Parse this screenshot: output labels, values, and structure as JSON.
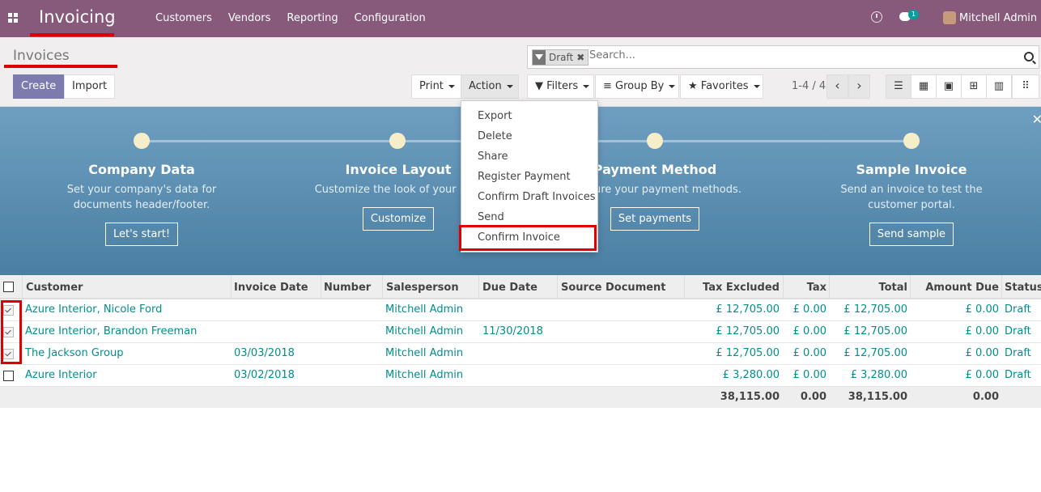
{
  "navbar": {
    "app_title": "Invoicing",
    "menu": [
      "Customers",
      "Vendors",
      "Reporting",
      "Configuration"
    ],
    "chat_badge": "1",
    "user_name": "Mitchell Admin"
  },
  "control_panel": {
    "title": "Invoices",
    "facet_label": "Draft",
    "facet_close": "✖",
    "search_placeholder": "Search...",
    "create_label": "Create",
    "import_label": "Import",
    "print_label": "Print",
    "action_label": "Action",
    "filters_label": "Filters",
    "groupby_label": "Group By",
    "favorites_label": "Favorites",
    "pager": "1-4 / 4",
    "prev": "‹",
    "next": "›"
  },
  "action_menu": {
    "items": [
      "Export",
      "Delete",
      "Share",
      "Register Payment",
      "Confirm Draft Invoices",
      "Send",
      "Confirm Invoice"
    ]
  },
  "banner": {
    "close": "✕",
    "steps": [
      {
        "title": "Company Data",
        "desc1": "Set your company's data for",
        "desc2": "documents header/footer.",
        "button": "Let's start!"
      },
      {
        "title": "Invoice Layout",
        "desc1": "Customize the look of your invo",
        "desc2": "",
        "button": "Customize"
      },
      {
        "title": "Payment Method",
        "desc1": "igure your payment methods.",
        "desc2": "",
        "button": "Set payments"
      },
      {
        "title": "Sample Invoice",
        "desc1": "Send an invoice to test the",
        "desc2": "customer portal.",
        "button": "Send sample"
      }
    ]
  },
  "table": {
    "headers": [
      "Customer",
      "Invoice Date",
      "Number",
      "Salesperson",
      "Due Date",
      "Source Document",
      "Tax Excluded",
      "Tax",
      "Total",
      "Amount Due",
      "Status"
    ],
    "rows": [
      {
        "checked": true,
        "customer": "Azure Interior, Nicole Ford",
        "invoice_date": "",
        "number": "",
        "salesperson": "Mitchell Admin",
        "due_date": "",
        "source": "",
        "tax_excluded": "£ 12,705.00",
        "tax": "£ 0.00",
        "total": "£ 12,705.00",
        "amount_due": "£ 0.00",
        "status": "Draft"
      },
      {
        "checked": true,
        "customer": "Azure Interior, Brandon Freeman",
        "invoice_date": "",
        "number": "",
        "salesperson": "Mitchell Admin",
        "due_date": "11/30/2018",
        "source": "",
        "tax_excluded": "£ 12,705.00",
        "tax": "£ 0.00",
        "total": "£ 12,705.00",
        "amount_due": "£ 0.00",
        "status": "Draft"
      },
      {
        "checked": true,
        "customer": "The Jackson Group",
        "invoice_date": "03/03/2018",
        "number": "",
        "salesperson": "Mitchell Admin",
        "due_date": "",
        "source": "",
        "tax_excluded": "£ 12,705.00",
        "tax": "£ 0.00",
        "total": "£ 12,705.00",
        "amount_due": "£ 0.00",
        "status": "Draft"
      },
      {
        "checked": false,
        "customer": "Azure Interior",
        "invoice_date": "03/02/2018",
        "number": "",
        "salesperson": "Mitchell Admin",
        "due_date": "",
        "source": "",
        "tax_excluded": "£ 3,280.00",
        "tax": "£ 0.00",
        "total": "£ 3,280.00",
        "amount_due": "£ 0.00",
        "status": "Draft"
      }
    ],
    "totals": {
      "tax_excluded": "38,115.00",
      "tax": "0.00",
      "total": "38,115.00",
      "amount_due": "0.00"
    }
  }
}
